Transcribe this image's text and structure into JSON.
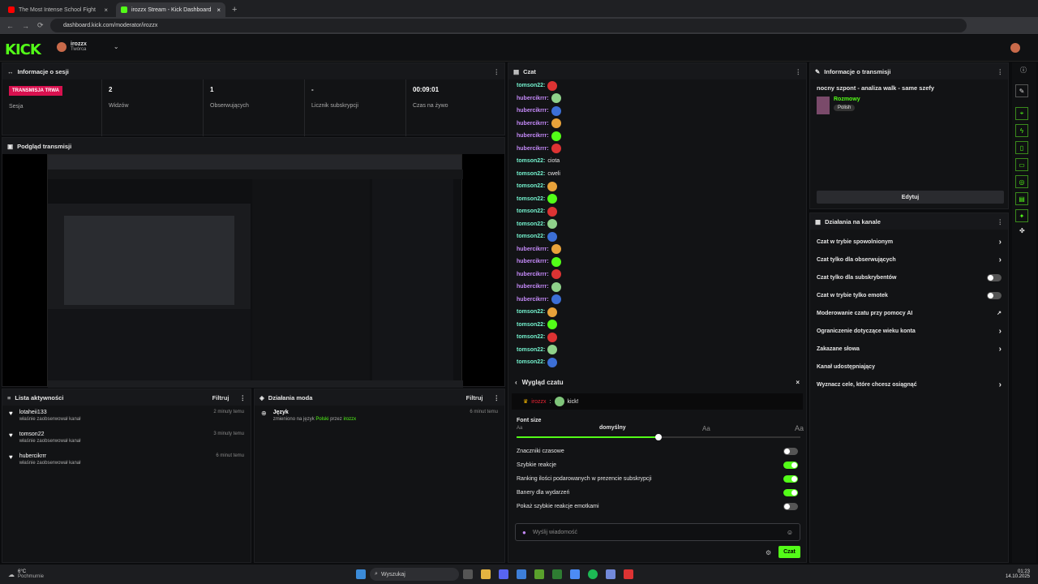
{
  "browser": {
    "tabs": [
      {
        "title": "The Most Intense School Fight"
      },
      {
        "title": "irozzx Stream - Kick Dashboard"
      }
    ],
    "url": "dashboard.kick.com/moderator/irozzx"
  },
  "header": {
    "username": "irozzx",
    "role": "Twórca",
    "logo": "KICK"
  },
  "session": {
    "title": "Informacje o sesji",
    "live": "TRANSMISJA TRWA",
    "live_label": "Sesja",
    "viewers": "2",
    "viewers_label": "Widzów",
    "followers": "1",
    "followers_label": "Obserwujących",
    "subs": "-",
    "subs_label": "Licznik subskrypcji",
    "time": "00:09:01",
    "time_label": "Czas na żywo"
  },
  "preview": {
    "title": "Podgląd transmisji"
  },
  "activity": {
    "title": "Lista aktywności",
    "filter": "Filtruj",
    "items": [
      {
        "name": "lotaheii133",
        "desc": "właśnie zaobserwował kanał",
        "time": "2 minuty temu"
      },
      {
        "name": "tomson22",
        "desc": "właśnie zaobserwował kanał",
        "time": "3 minuty temu"
      },
      {
        "name": "hubercikrrr",
        "desc": "właśnie zaobserwował kanał",
        "time": "6 minut temu"
      }
    ]
  },
  "mod": {
    "title": "Działania moda",
    "filter": "Filtruj",
    "items": [
      {
        "name": "Język",
        "desc_pre": "zmieniono na język",
        "lang": "Polski",
        "by": "przez",
        "user": "irozzx",
        "time": "6 minut temu"
      }
    ]
  },
  "chat": {
    "title": "Czat",
    "lines": [
      {
        "u": "tomson22:",
        "c": "u1",
        "msg": ""
      },
      {
        "u": "hubercikrrr:",
        "c": "u2",
        "msg": ""
      },
      {
        "u": "hubercikrrr:",
        "c": "u2",
        "msg": ""
      },
      {
        "u": "hubercikrrr:",
        "c": "u2",
        "msg": ""
      },
      {
        "u": "hubercikrrr:",
        "c": "u2",
        "msg": ""
      },
      {
        "u": "hubercikrrr:",
        "c": "u2",
        "msg": ""
      },
      {
        "u": "tomson22:",
        "c": "u1",
        "msg": "ciota"
      },
      {
        "u": "tomson22:",
        "c": "u1",
        "msg": "cweli"
      },
      {
        "u": "tomson22:",
        "c": "u1",
        "msg": ""
      },
      {
        "u": "tomson22:",
        "c": "u1",
        "msg": ""
      },
      {
        "u": "tomson22:",
        "c": "u1",
        "msg": ""
      },
      {
        "u": "tomson22:",
        "c": "u1",
        "msg": ""
      },
      {
        "u": "tomson22:",
        "c": "u1",
        "msg": ""
      },
      {
        "u": "hubercikrrr:",
        "c": "u2",
        "msg": ""
      },
      {
        "u": "hubercikrrr:",
        "c": "u2",
        "msg": ""
      },
      {
        "u": "hubercikrrr:",
        "c": "u2",
        "msg": ""
      },
      {
        "u": "hubercikrrr:",
        "c": "u2",
        "msg": ""
      },
      {
        "u": "hubercikrrr:",
        "c": "u2",
        "msg": ""
      },
      {
        "u": "tomson22:",
        "c": "u1",
        "msg": ""
      },
      {
        "u": "tomson22:",
        "c": "u1",
        "msg": ""
      },
      {
        "u": "tomson22:",
        "c": "u1",
        "msg": ""
      },
      {
        "u": "tomson22:",
        "c": "u1",
        "msg": ""
      },
      {
        "u": "tomson22:",
        "c": "u1",
        "msg": ""
      }
    ],
    "appearance": {
      "title": "Wygląd czatu",
      "preview_user": "irozzx",
      "preview_msg": "kick!",
      "font_size": "Font size",
      "font_default": "domyślny",
      "font_sizes": [
        "Aa",
        "Aa",
        "Aa"
      ],
      "font_level": 0.5,
      "toggles": [
        {
          "label": "Znaczniki czasowe",
          "on": false
        },
        {
          "label": "Szybkie reakcje",
          "on": true
        },
        {
          "label": "Ranking ilości podarowanych w prezencie subskrypcji",
          "on": true
        },
        {
          "label": "Banery dla wydarzeń",
          "on": true
        },
        {
          "label": "Pokaż szybkie reakcje emotkami",
          "on": false
        }
      ]
    },
    "input_placeholder": "Wyślij wiadomość",
    "send": "Czat"
  },
  "stream_info": {
    "title": "Informacje o transmisji",
    "stream_title": "nocny szpont - analiza walk - same szefy",
    "category": "Rozmowy",
    "language": "Polish",
    "edit": "Edytuj"
  },
  "channel": {
    "title": "Działania na kanale",
    "items": [
      {
        "label": "Czat w trybie spowolnionym",
        "ctrl": "arrow"
      },
      {
        "label": "Czat tylko dla obserwujących",
        "ctrl": "arrow"
      },
      {
        "label": "Czat tylko dla subskrybentów",
        "ctrl": "toggle"
      },
      {
        "label": "Czat w trybie tylko emotek",
        "ctrl": "toggle"
      },
      {
        "label": "Moderowanie czatu przy pomocy AI",
        "ctrl": "ext"
      },
      {
        "label": "Ograniczenie dotyczące wieku konta",
        "ctrl": "arrow"
      },
      {
        "label": "Zakazane słowa",
        "ctrl": "arrow"
      },
      {
        "label": "Kanał udostępniający",
        "ctrl": "none"
      },
      {
        "label": "Wyznacz cele, które chcesz osiągnąć",
        "ctrl": "arrow"
      }
    ]
  },
  "taskbar": {
    "weather": "6°C",
    "weather_desc": "Pochmurnie",
    "search": "Wyszukaj",
    "time": "01:23",
    "date": "14.10.2025"
  }
}
